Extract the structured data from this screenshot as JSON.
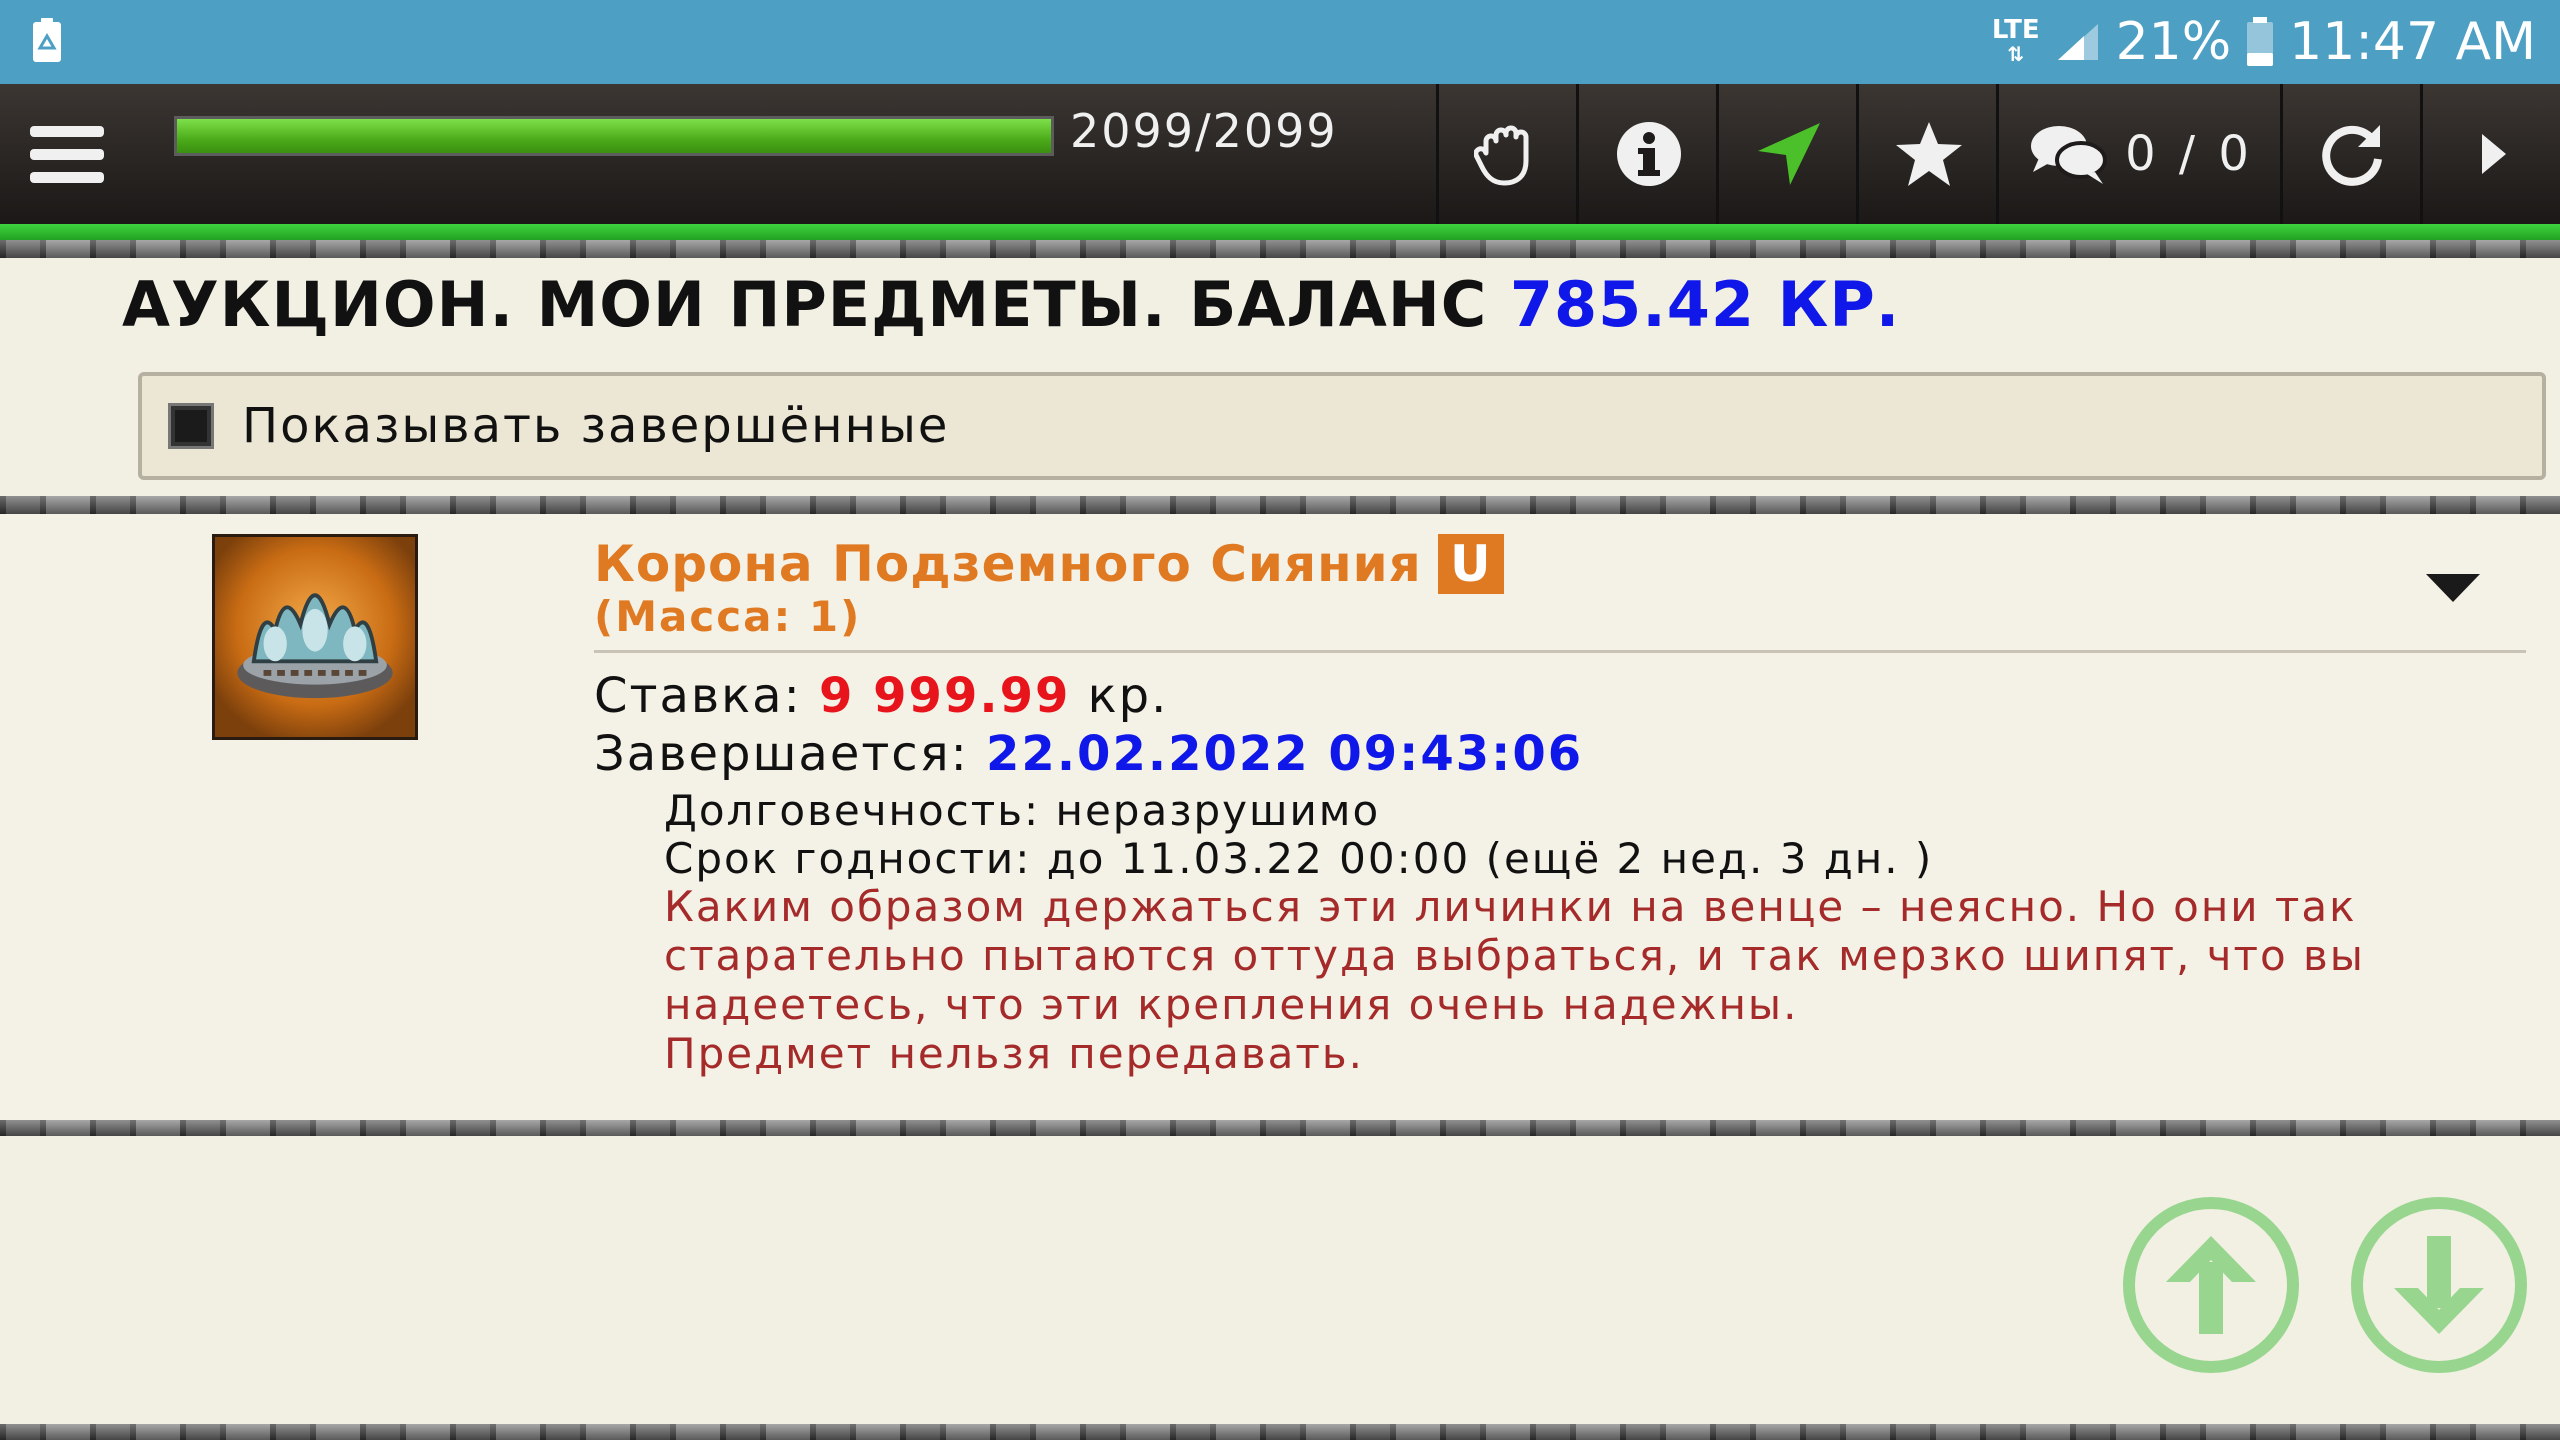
{
  "status_bar": {
    "network": "LTE",
    "battery": "21%",
    "time": "11:47 AM",
    "left_icon": "recycle-notification-icon"
  },
  "toolbar": {
    "hp_text": "2099/2099",
    "hp_fraction": 1.0,
    "chat_count": "0 / 0",
    "buttons": [
      "hand-icon",
      "info-icon",
      "navigate-arrow-icon",
      "star-icon",
      "chat-icon",
      "refresh-icon",
      "play-icon"
    ],
    "accent_green": "#3bb23b"
  },
  "header": {
    "title": "АУКЦИОН. МОИ ПРЕДМЕТЫ. БАЛАНС",
    "balance": "785.42 КР.",
    "balance_color": "#0f18e8"
  },
  "filter": {
    "label": "Показывать завершённые",
    "checked": false
  },
  "lot": {
    "name": "Корона Подземного Сияния",
    "badge": "U",
    "mass": "(Масса: 1)",
    "bid_label": "Ставка:",
    "bid_value": "9 999.99",
    "bid_unit": "кр.",
    "end_label": "Завершается:",
    "end_value": "22.02.2022 09:43:06",
    "durability": "Долговечность: неразрушимо",
    "expiry": "Срок годности: до 11.03.22 00:00 (ещё 2 нед. 3 дн. )",
    "description": "Каким образом держаться эти личинки на венце – неясно. Но они так старательно пытаются оттуда выбраться, и так мерзко шипят, что вы надеетесь, что эти крепления очень надежны.",
    "note": "Предмет нельзя передавать."
  },
  "scroll": {
    "up": "arrow-up-circle-icon",
    "down": "arrow-down-circle-icon",
    "color": "#98d690"
  }
}
